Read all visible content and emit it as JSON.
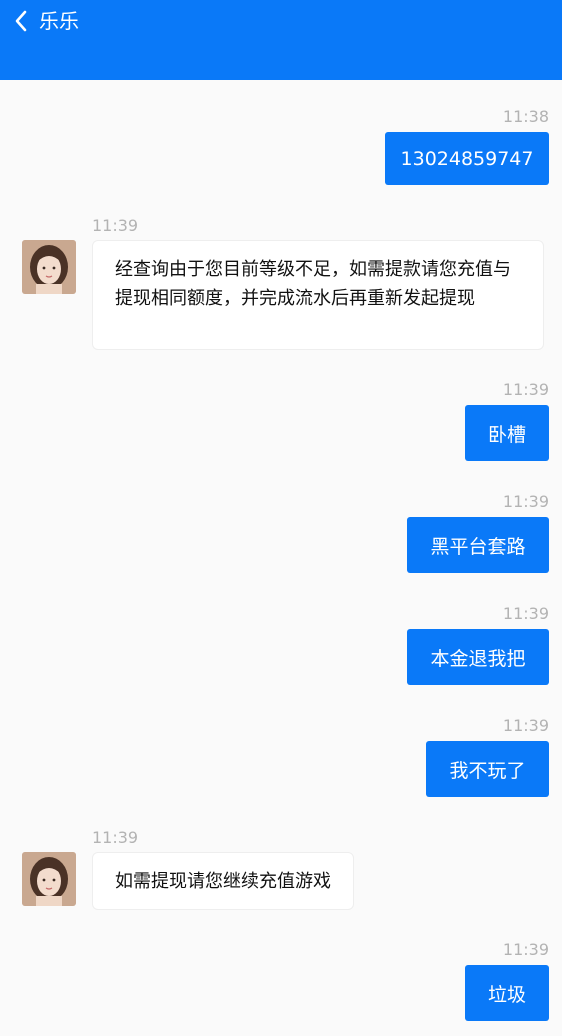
{
  "header": {
    "title": "乐乐",
    "back_icon": "chevron-left-icon",
    "background_color": "#0a79f8"
  },
  "colors": {
    "outgoing_bubble": "#0a79f8",
    "incoming_bubble": "#ffffff",
    "timestamp": "#b3b3b3"
  },
  "messages": [
    {
      "direction": "outgoing",
      "time": "11:38",
      "text": "13024859747"
    },
    {
      "direction": "incoming",
      "time": "11:39",
      "text": "经查询由于您目前等级不足，如需提款请您充值与提现相同额度，并完成流水后再重新发起提现"
    },
    {
      "direction": "outgoing",
      "time": "11:39",
      "text": "卧槽"
    },
    {
      "direction": "outgoing",
      "time": "11:39",
      "text": "黑平台套路"
    },
    {
      "direction": "outgoing",
      "time": "11:39",
      "text": "本金退我把"
    },
    {
      "direction": "outgoing",
      "time": "11:39",
      "text": "我不玩了"
    },
    {
      "direction": "incoming",
      "time": "11:39",
      "text": "如需提现请您继续充值游戏"
    },
    {
      "direction": "outgoing",
      "time": "11:39",
      "text": "垃圾"
    }
  ]
}
